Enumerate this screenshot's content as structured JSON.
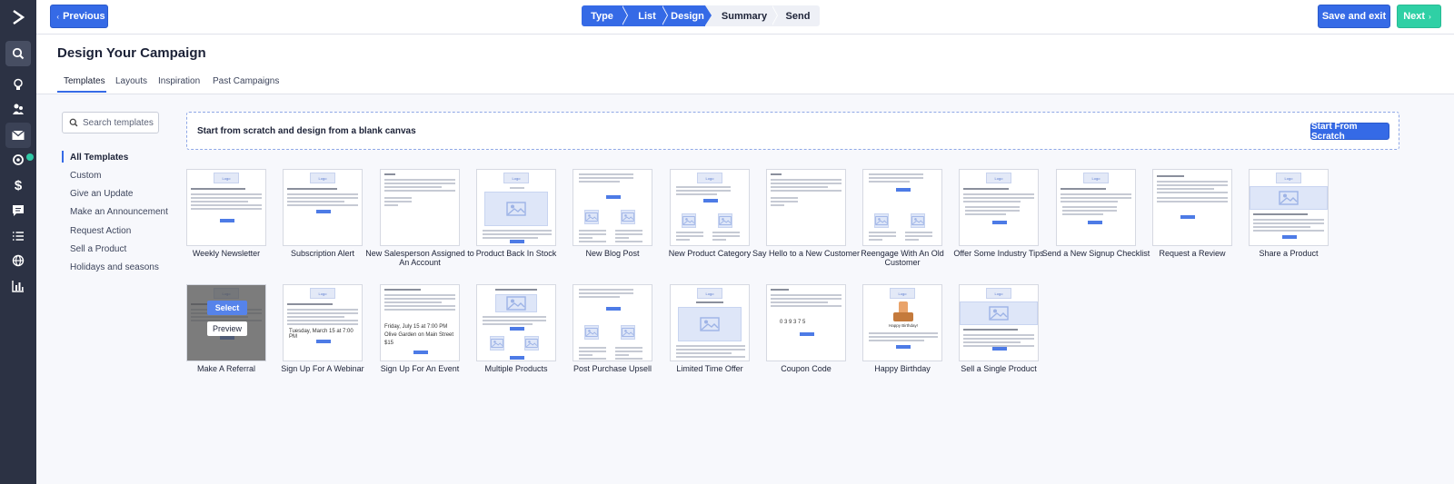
{
  "colors": {
    "accent": "#356ae6",
    "next": "#2fd0a5",
    "rail": "#2c3244",
    "step_todo": "#eef0f6"
  },
  "rail_icons": [
    "activecampaign-logo-icon",
    "search-icon",
    "lightbulb-icon",
    "contacts-icon",
    "mail-icon",
    "automation-icon",
    "dollar-icon",
    "chat-icon",
    "list-icon",
    "globe-icon",
    "bar-chart-icon"
  ],
  "topbar": {
    "previous_label": "Previous",
    "save_exit_label": "Save and exit",
    "next_label": "Next",
    "steps": [
      "Type",
      "List",
      "Design",
      "Summary",
      "Send"
    ]
  },
  "header": {
    "title": "Design Your Campaign",
    "tabs": [
      "Templates",
      "Layouts",
      "Inspiration",
      "Past Campaigns"
    ]
  },
  "sidebar": {
    "search_placeholder": "Search templates",
    "categories": [
      "All Templates",
      "Custom",
      "Give an Update",
      "Make an Announcement",
      "Request Action",
      "Sell a Product",
      "Holidays and seasons"
    ]
  },
  "scratch": {
    "text": "Start from scratch and design from a blank canvas",
    "button_label": "Start From Scratch"
  },
  "thumb_logo": "Logo",
  "hover": {
    "select_label": "Select",
    "preview_label": "Preview"
  },
  "thumb_texts": {
    "webinar_date": "Tuesday, March 15 at 7:00 PM",
    "event_date": "Friday, July 15 at 7:00 PM",
    "event_place": "Olive Garden on Main Street",
    "event_price": "$15",
    "coupon_code": "0 3 9 3 7 5",
    "birthday": "Happy Birthday!"
  },
  "templates": [
    {
      "name": "Weekly Newsletter"
    },
    {
      "name": "Subscription Alert"
    },
    {
      "name": "New Salesperson Assigned to An Account"
    },
    {
      "name": "Product Back In Stock"
    },
    {
      "name": "New Blog Post"
    },
    {
      "name": "New Product Category"
    },
    {
      "name": "Say Hello to a New Customer"
    },
    {
      "name": "Reengage With An Old Customer"
    },
    {
      "name": "Offer Some Industry Tips"
    },
    {
      "name": "Send a New Signup Checklist"
    },
    {
      "name": "Request a Review"
    },
    {
      "name": "Share a Product"
    },
    {
      "name": "Make A Referral"
    },
    {
      "name": "Sign Up For A Webinar"
    },
    {
      "name": "Sign Up For An Event"
    },
    {
      "name": "Multiple Products"
    },
    {
      "name": "Post Purchase Upsell"
    },
    {
      "name": "Limited Time Offer"
    },
    {
      "name": "Coupon Code"
    },
    {
      "name": "Happy Birthday"
    },
    {
      "name": "Sell a Single Product"
    }
  ]
}
